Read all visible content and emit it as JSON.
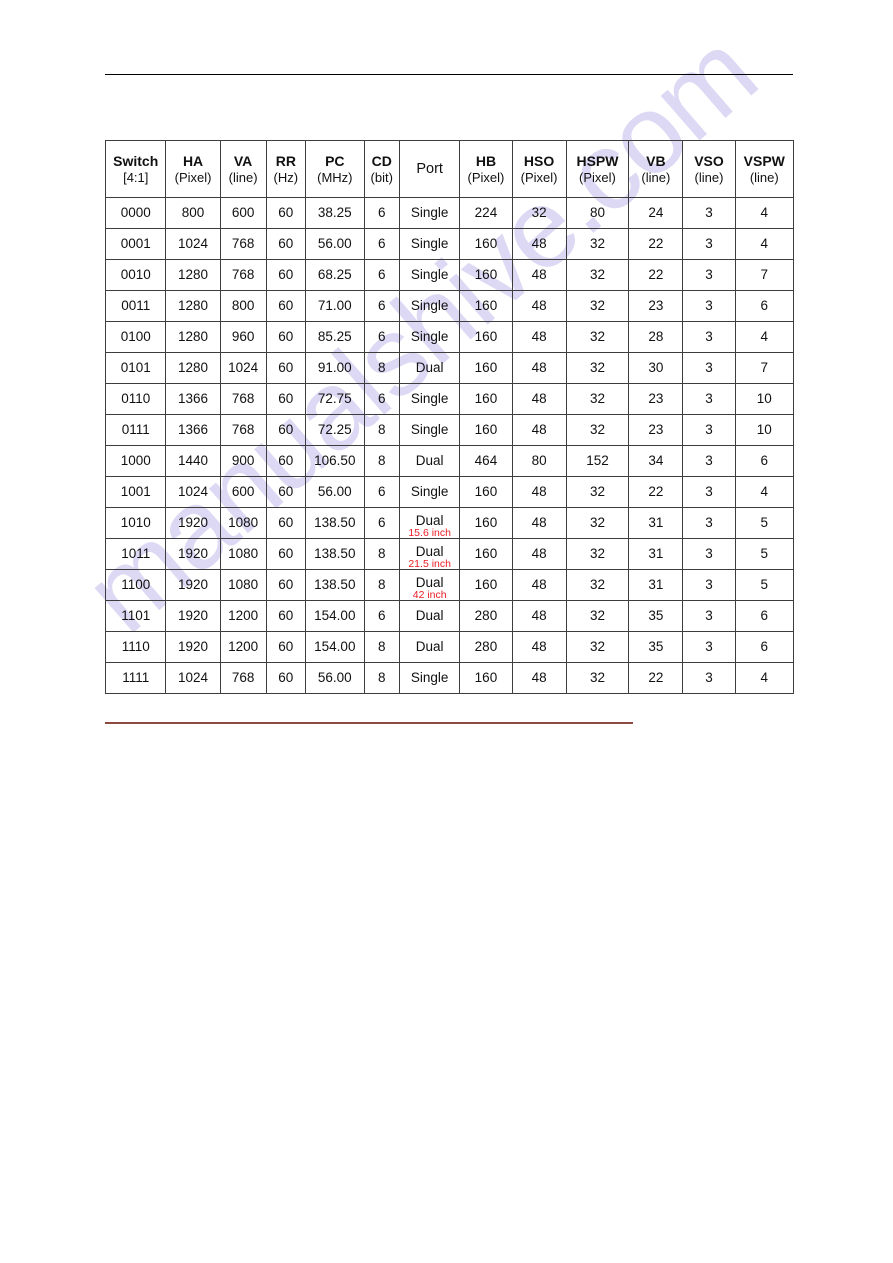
{
  "document": {
    "watermark_text": "manualshive.com",
    "rule_color_header": "#000000",
    "rule_color_footer": "#8c4a40",
    "annotation_color": "#ec1c24"
  },
  "table": {
    "columns": [
      {
        "key": "switch",
        "name": "Switch",
        "unit": "[4:1]"
      },
      {
        "key": "ha",
        "name": "HA",
        "unit": "(Pixel)"
      },
      {
        "key": "va",
        "name": "VA",
        "unit": "(line)"
      },
      {
        "key": "rr",
        "name": "RR",
        "unit": "(Hz)"
      },
      {
        "key": "pc",
        "name": "PC",
        "unit": "(MHz)"
      },
      {
        "key": "cd",
        "name": "CD",
        "unit": "(bit)"
      },
      {
        "key": "port",
        "name": "Port",
        "unit": ""
      },
      {
        "key": "hb",
        "name": "HB",
        "unit": "(Pixel)"
      },
      {
        "key": "hso",
        "name": "HSO",
        "unit": "(Pixel)"
      },
      {
        "key": "hspw",
        "name": "HSPW",
        "unit": "(Pixel)"
      },
      {
        "key": "vb",
        "name": "VB",
        "unit": "(line)"
      },
      {
        "key": "vso",
        "name": "VSO",
        "unit": "(line)"
      },
      {
        "key": "vspw",
        "name": "VSPW",
        "unit": "(line)"
      }
    ],
    "rows": [
      {
        "switch": "0000",
        "ha": "800",
        "va": "600",
        "rr": "60",
        "pc": "38.25",
        "cd": "6",
        "port": "Single",
        "port_note": "",
        "hb": "224",
        "hso": "32",
        "hspw": "80",
        "vb": "24",
        "vso": "3",
        "vspw": "4"
      },
      {
        "switch": "0001",
        "ha": "1024",
        "va": "768",
        "rr": "60",
        "pc": "56.00",
        "cd": "6",
        "port": "Single",
        "port_note": "",
        "hb": "160",
        "hso": "48",
        "hspw": "32",
        "vb": "22",
        "vso": "3",
        "vspw": "4"
      },
      {
        "switch": "0010",
        "ha": "1280",
        "va": "768",
        "rr": "60",
        "pc": "68.25",
        "cd": "6",
        "port": "Single",
        "port_note": "",
        "hb": "160",
        "hso": "48",
        "hspw": "32",
        "vb": "22",
        "vso": "3",
        "vspw": "7"
      },
      {
        "switch": "0011",
        "ha": "1280",
        "va": "800",
        "rr": "60",
        "pc": "71.00",
        "cd": "6",
        "port": "Single",
        "port_note": "",
        "hb": "160",
        "hso": "48",
        "hspw": "32",
        "vb": "23",
        "vso": "3",
        "vspw": "6"
      },
      {
        "switch": "0100",
        "ha": "1280",
        "va": "960",
        "rr": "60",
        "pc": "85.25",
        "cd": "6",
        "port": "Single",
        "port_note": "",
        "hb": "160",
        "hso": "48",
        "hspw": "32",
        "vb": "28",
        "vso": "3",
        "vspw": "4"
      },
      {
        "switch": "0101",
        "ha": "1280",
        "va": "1024",
        "rr": "60",
        "pc": "91.00",
        "cd": "8",
        "port": "Dual",
        "port_note": "",
        "hb": "160",
        "hso": "48",
        "hspw": "32",
        "vb": "30",
        "vso": "3",
        "vspw": "7"
      },
      {
        "switch": "0110",
        "ha": "1366",
        "va": "768",
        "rr": "60",
        "pc": "72.75",
        "cd": "6",
        "port": "Single",
        "port_note": "",
        "hb": "160",
        "hso": "48",
        "hspw": "32",
        "vb": "23",
        "vso": "3",
        "vspw": "10"
      },
      {
        "switch": "0111",
        "ha": "1366",
        "va": "768",
        "rr": "60",
        "pc": "72.25",
        "cd": "8",
        "port": "Single",
        "port_note": "",
        "hb": "160",
        "hso": "48",
        "hspw": "32",
        "vb": "23",
        "vso": "3",
        "vspw": "10"
      },
      {
        "switch": "1000",
        "ha": "1440",
        "va": "900",
        "rr": "60",
        "pc": "106.50",
        "cd": "8",
        "port": "Dual",
        "port_note": "",
        "hb": "464",
        "hso": "80",
        "hspw": "152",
        "vb": "34",
        "vso": "3",
        "vspw": "6"
      },
      {
        "switch": "1001",
        "ha": "1024",
        "va": "600",
        "rr": "60",
        "pc": "56.00",
        "cd": "6",
        "port": "Single",
        "port_note": "",
        "hb": "160",
        "hso": "48",
        "hspw": "32",
        "vb": "22",
        "vso": "3",
        "vspw": "4"
      },
      {
        "switch": "1010",
        "ha": "1920",
        "va": "1080",
        "rr": "60",
        "pc": "138.50",
        "cd": "6",
        "port": "Dual",
        "port_note": "15.6 inch",
        "hb": "160",
        "hso": "48",
        "hspw": "32",
        "vb": "31",
        "vso": "3",
        "vspw": "5"
      },
      {
        "switch": "1011",
        "ha": "1920",
        "va": "1080",
        "rr": "60",
        "pc": "138.50",
        "cd": "8",
        "port": "Dual",
        "port_note": "21.5 inch",
        "hb": "160",
        "hso": "48",
        "hspw": "32",
        "vb": "31",
        "vso": "3",
        "vspw": "5"
      },
      {
        "switch": "1100",
        "ha": "1920",
        "va": "1080",
        "rr": "60",
        "pc": "138.50",
        "cd": "8",
        "port": "Dual",
        "port_note": "42 inch",
        "hb": "160",
        "hso": "48",
        "hspw": "32",
        "vb": "31",
        "vso": "3",
        "vspw": "5"
      },
      {
        "switch": "1101",
        "ha": "1920",
        "va": "1200",
        "rr": "60",
        "pc": "154.00",
        "cd": "6",
        "port": "Dual",
        "port_note": "",
        "hb": "280",
        "hso": "48",
        "hspw": "32",
        "vb": "35",
        "vso": "3",
        "vspw": "6"
      },
      {
        "switch": "1110",
        "ha": "1920",
        "va": "1200",
        "rr": "60",
        "pc": "154.00",
        "cd": "8",
        "port": "Dual",
        "port_note": "",
        "hb": "280",
        "hso": "48",
        "hspw": "32",
        "vb": "35",
        "vso": "3",
        "vspw": "6"
      },
      {
        "switch": "1111",
        "ha": "1024",
        "va": "768",
        "rr": "60",
        "pc": "56.00",
        "cd": "8",
        "port": "Single",
        "port_note": "",
        "hb": "160",
        "hso": "48",
        "hspw": "32",
        "vb": "22",
        "vso": "3",
        "vspw": "4"
      }
    ]
  }
}
